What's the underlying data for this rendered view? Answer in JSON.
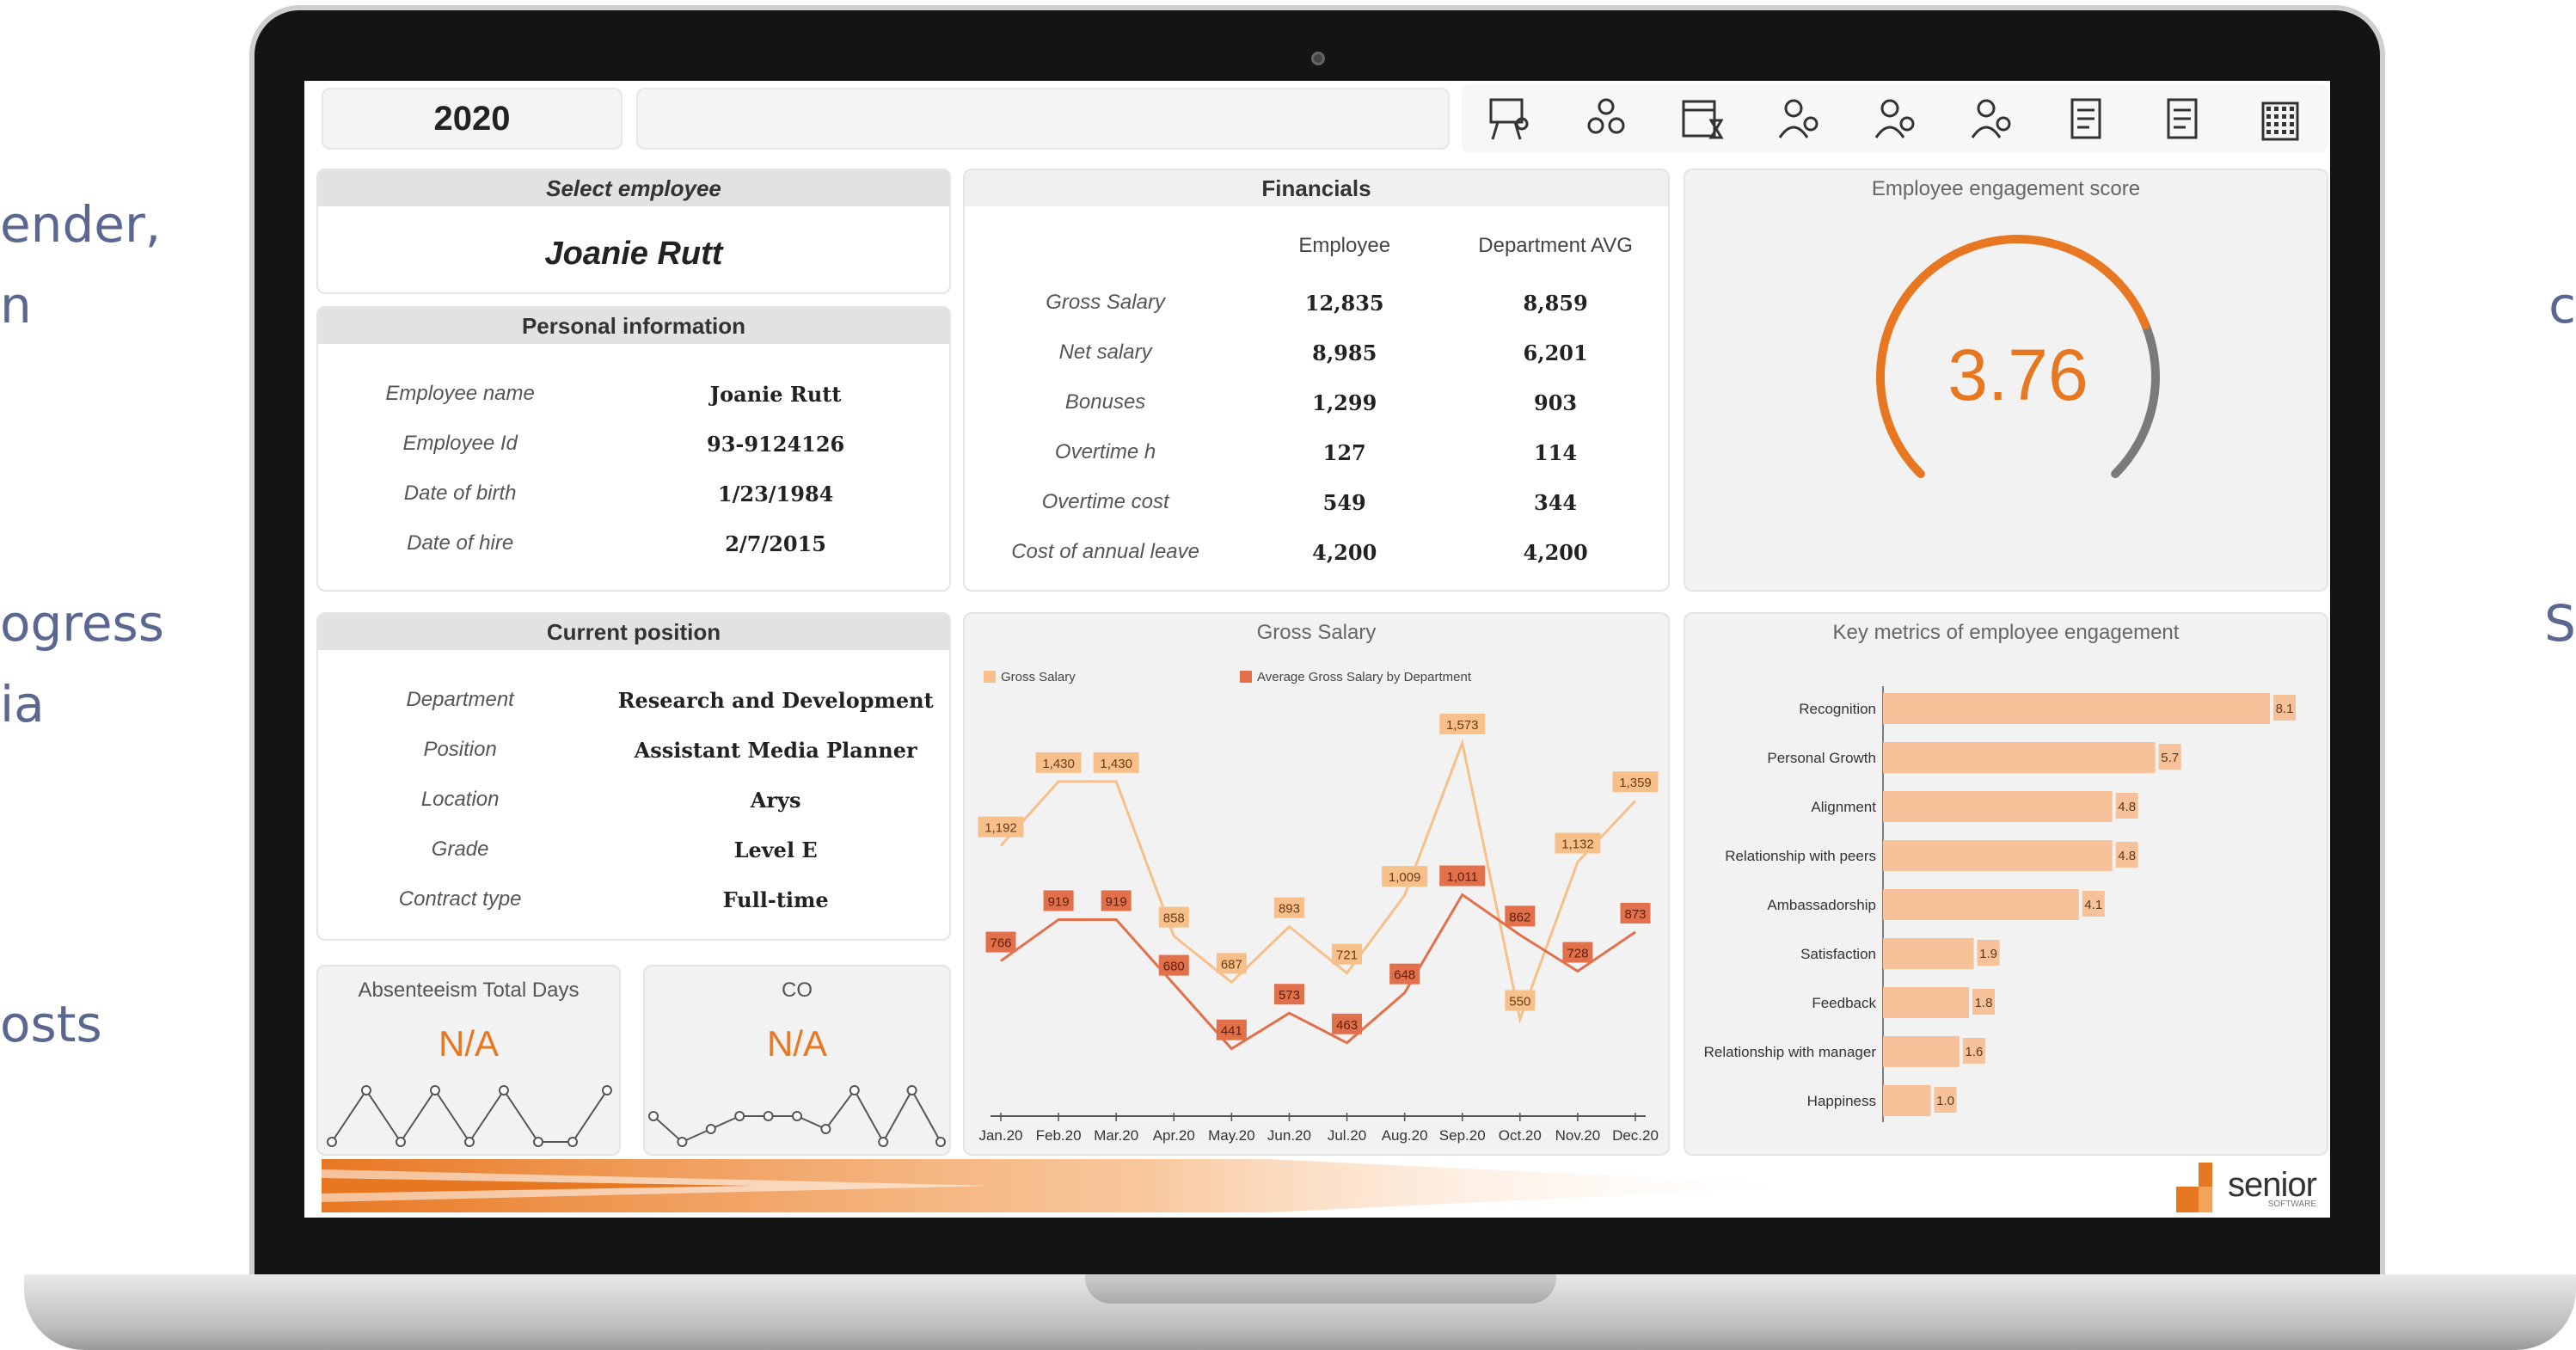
{
  "side_text": {
    "left": [
      "ender,",
      "n",
      "ogress",
      "ia",
      "osts"
    ],
    "right": [
      "c",
      "S"
    ]
  },
  "header": {
    "year": "2020",
    "toolbar_icons": [
      "presentation-icon",
      "team-network-icon",
      "calendar-icon",
      "employee-rating-icon",
      "employee-settings-icon",
      "employee-payment-icon",
      "report-document-icon",
      "financial-document-icon",
      "building-icon"
    ]
  },
  "select_employee": {
    "title": "Select employee",
    "selected": "Joanie Rutt"
  },
  "personal_information": {
    "title": "Personal information",
    "rows": [
      {
        "label": "Employee name",
        "value": "Joanie Rutt"
      },
      {
        "label": "Employee Id",
        "value": "93-9124126"
      },
      {
        "label": "Date of birth",
        "value": "1/23/1984"
      },
      {
        "label": "Date of hire",
        "value": "2/7/2015"
      }
    ]
  },
  "current_position": {
    "title": "Current position",
    "rows": [
      {
        "label": "Department",
        "value": "Research and Development"
      },
      {
        "label": "Position",
        "value": "Assistant Media Planner"
      },
      {
        "label": "Location",
        "value": "Arys"
      },
      {
        "label": "Grade",
        "value": "Level E"
      },
      {
        "label": "Contract type",
        "value": "Full-time"
      }
    ]
  },
  "financials": {
    "title": "Financials",
    "col_employee": "Employee",
    "col_department": "Department AVG",
    "rows": [
      {
        "label": "Gross Salary",
        "employee": "12,835",
        "department": "8,859"
      },
      {
        "label": "Net salary",
        "employee": "8,985",
        "department": "6,201"
      },
      {
        "label": "Bonuses",
        "employee": "1,299",
        "department": "903"
      },
      {
        "label": "Overtime h",
        "employee": "127",
        "department": "114"
      },
      {
        "label": "Overtime cost",
        "employee": "549",
        "department": "344"
      },
      {
        "label": "Cost of annual leave",
        "employee": "4,200",
        "department": "4,200"
      }
    ]
  },
  "engagement_score": {
    "title": "Employee engagement score",
    "value": "3.76",
    "scale_max": 5
  },
  "absenteeism": {
    "title": "Absenteeism Total Days",
    "value": "N/A",
    "sparkline": [
      1,
      3,
      1,
      3,
      1,
      3,
      1,
      1,
      3
    ]
  },
  "co": {
    "title": "CO",
    "value": "N/A",
    "sparkline": [
      2,
      1,
      1.5,
      2,
      2,
      2,
      1.5,
      3,
      1,
      3,
      1
    ]
  },
  "colors": {
    "accent": "#e87722",
    "series_light": "#f7c08a",
    "series_dark": "#e2704a",
    "bar": "#f7c29a"
  },
  "chart_data": [
    {
      "type": "line",
      "title": "Gross Salary",
      "categories": [
        "Jan.20",
        "Feb.20",
        "Mar.20",
        "Apr.20",
        "May.20",
        "Jun.20",
        "Jul.20",
        "Aug.20",
        "Sep.20",
        "Oct.20",
        "Nov.20",
        "Dec.20"
      ],
      "series": [
        {
          "name": "Gross Salary",
          "values": [
            1192,
            1430,
            1430,
            858,
            687,
            893,
            721,
            1009,
            1573,
            550,
            1132,
            1359
          ],
          "labels": [
            "1,192",
            "1,430",
            "1,430",
            "858",
            "687",
            "893",
            "721",
            "1,009",
            "1,573",
            "550",
            "1,132",
            "1,359"
          ]
        },
        {
          "name": "Average Gross Salary by Department",
          "values": [
            766,
            919,
            919,
            680,
            441,
            573,
            463,
            648,
            1011,
            862,
            728,
            873
          ],
          "labels": [
            "766",
            "919",
            "919",
            "680",
            "441",
            "573",
            "463",
            "648",
            "1,011",
            "862",
            "728",
            "873"
          ]
        }
      ],
      "ylim": [
        300,
        1700
      ],
      "grid": false,
      "legend": "top-left"
    },
    {
      "type": "bar",
      "orientation": "horizontal",
      "title": "Key metrics of employee engagement",
      "categories": [
        "Recognition",
        "Personal Growth",
        "Alignment",
        "Relationship with peers",
        "Ambassadorship",
        "Satisfaction",
        "Feedback",
        "Relationship with manager",
        "Happiness"
      ],
      "values": [
        8.1,
        5.7,
        4.8,
        4.8,
        4.1,
        1.9,
        1.8,
        1.6,
        1.0
      ],
      "labels": [
        "8.1",
        "5.7",
        "4.8",
        "4.8",
        "4.1",
        "1.9",
        "1.8",
        "1.6",
        "1.0"
      ],
      "xlim": [
        0,
        9
      ],
      "grid": false
    }
  ],
  "brand": {
    "name": "senior",
    "tagline": "SOFTWARE"
  }
}
